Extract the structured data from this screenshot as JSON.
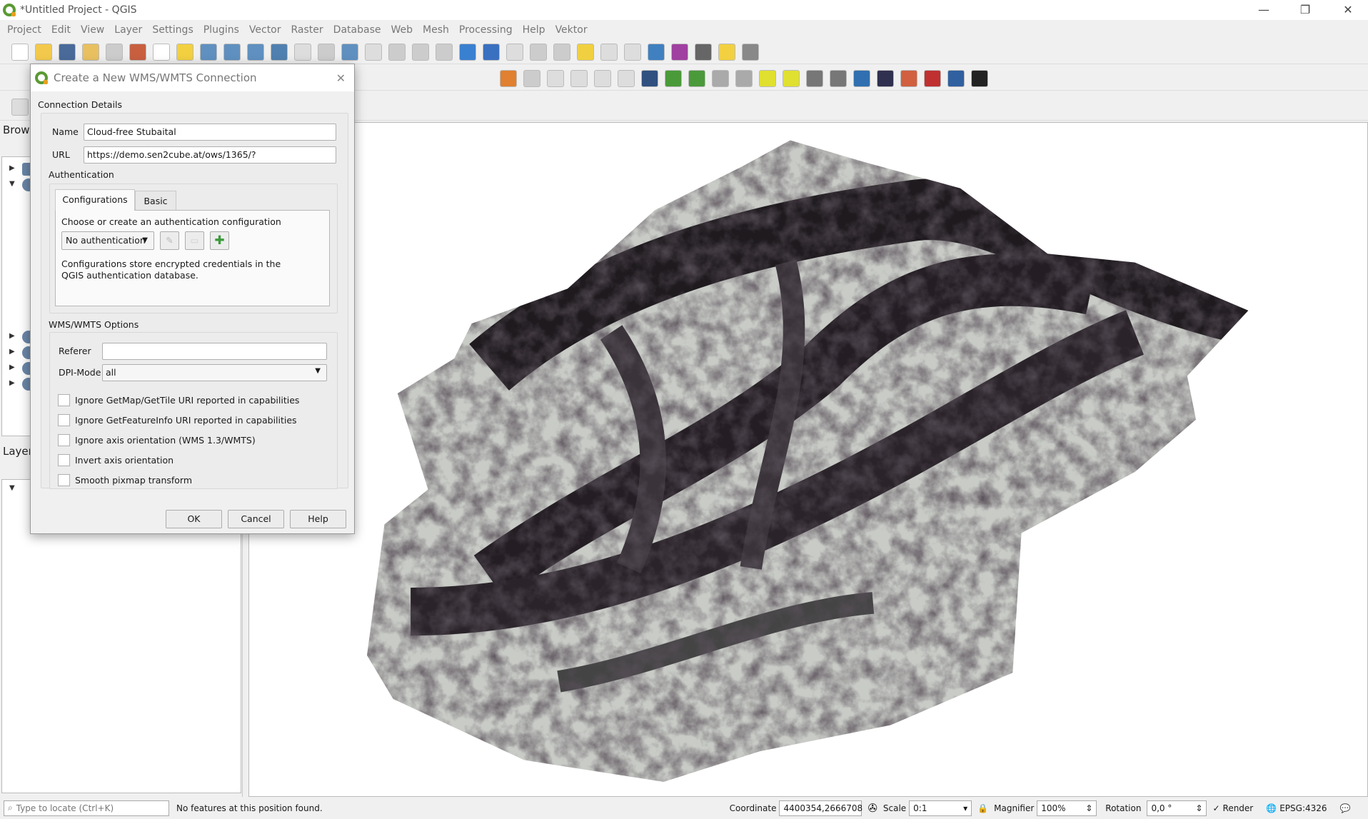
{
  "window": {
    "title": "*Untitled Project - QGIS",
    "minimize": "—",
    "restore": "❐",
    "close": "✕"
  },
  "menu": [
    "Project",
    "Edit",
    "View",
    "Layer",
    "Settings",
    "Plugins",
    "Vector",
    "Raster",
    "Database",
    "Web",
    "Mesh",
    "Processing",
    "Help",
    "Vektor"
  ],
  "toolbar1": [
    [
      "new-project",
      "#fff"
    ],
    [
      "open-project",
      "#f2c94c"
    ],
    [
      "save-project",
      "#4a6a9a"
    ],
    [
      "new-print-layout",
      "#e8c060"
    ],
    [
      "layout-manager",
      "#ccc"
    ],
    [
      "style-manager",
      "#c86040"
    ],
    [
      "pan",
      "#fff"
    ],
    [
      "pan-to-selection",
      "#f2d040"
    ],
    [
      "zoom-in",
      "#6090c0"
    ],
    [
      "zoom-out",
      "#6090c0"
    ],
    [
      "zoom-native",
      "#6090c0"
    ],
    [
      "zoom-full",
      "#5080b0"
    ],
    [
      "zoom-selection",
      "#ddd"
    ],
    [
      "zoom-layer",
      "#ccc"
    ],
    [
      "zoom-last",
      "#6090c0"
    ],
    [
      "zoom-next",
      "#ddd"
    ],
    [
      "new-map-view",
      "#ccc"
    ],
    [
      "new-3d-view",
      "#ccc"
    ],
    [
      "new-bookmark",
      "#ccc"
    ],
    [
      "refresh",
      "#3a80d0"
    ],
    [
      "identify",
      "#3a70c0"
    ],
    [
      "action",
      "#ddd"
    ],
    [
      "select",
      "#ccc"
    ],
    [
      "deselect",
      "#ccc"
    ],
    [
      "select-value",
      "#f0d040"
    ],
    [
      "attribute-table",
      "#ddd"
    ],
    [
      "field-calculator",
      "#ddd"
    ],
    [
      "processing-toolbox",
      "#4080c0"
    ],
    [
      "statistics",
      "#a040a0"
    ],
    [
      "measure",
      "#666"
    ],
    [
      "map-tips",
      "#f2d040"
    ],
    [
      "text-annotation",
      "#888"
    ]
  ],
  "toolbar2": [
    [
      "data-source-manager",
      "#e08030"
    ],
    [
      "cut",
      "#ccc"
    ],
    [
      "copy",
      "#ddd"
    ],
    [
      "paste",
      "#ddd"
    ],
    [
      "undo",
      "#ddd"
    ],
    [
      "redo",
      "#ddd"
    ],
    [
      "wms-search",
      "#305080"
    ],
    [
      "histogram",
      "#4a9a3a"
    ],
    [
      "histogram-stretch",
      "#4a9a3a"
    ],
    [
      "histogram-local",
      "#aaa"
    ],
    [
      "histogram-local-stretch",
      "#aaa"
    ],
    [
      "add-point",
      "#e0e030"
    ],
    [
      "add-line",
      "#e0e030"
    ],
    [
      "add-polygon",
      "#777"
    ],
    [
      "add-feature",
      "#777"
    ],
    [
      "python-console",
      "#3070b0"
    ],
    [
      "plugin-globe",
      "#303050"
    ],
    [
      "heatmap",
      "#d06040"
    ],
    [
      "wkt-tool",
      "#c03030"
    ],
    [
      "help",
      "#3060a0"
    ],
    [
      "s-plugin",
      "#222"
    ]
  ],
  "toolbar3": [
    [
      "new-layer",
      "#ddd"
    ]
  ],
  "browser": {
    "title": "Brows"
  },
  "layers": {
    "title": "Layers"
  },
  "dialog": {
    "title": "Create a New WMS/WMTS Connection",
    "connection_details": "Connection Details",
    "name_label": "Name",
    "name_value": "Cloud-free Stubaital",
    "url_label": "URL",
    "url_value": "https://demo.sen2cube.at/ows/1365/?",
    "auth_label": "Authentication",
    "tabs": [
      "Configurations",
      "Basic"
    ],
    "auth_choose": "Choose or create an authentication configuration",
    "auth_select": "No authentication",
    "auth_note": "Configurations store encrypted credentials in the QGIS authentication database.",
    "options_label": "WMS/WMTS Options",
    "referer_label": "Referer",
    "referer_value": "",
    "dpi_label": "DPI-Mode",
    "dpi_value": "all",
    "checkboxes": [
      {
        "label": "Ignore GetMap/GetTile URI reported in capabilities",
        "checked": false
      },
      {
        "label": "Ignore GetFeatureInfo URI reported in capabilities",
        "checked": false
      },
      {
        "label": "Ignore axis orientation (WMS 1.3/WMTS)",
        "checked": false
      },
      {
        "label": "Invert axis orientation",
        "checked": false
      },
      {
        "label": "Smooth pixmap transform",
        "checked": false
      }
    ],
    "ok": "OK",
    "cancel": "Cancel",
    "help": "Help"
  },
  "status": {
    "locate_placeholder": "Type to locate (Ctrl+K)",
    "message": "No features at this position found.",
    "coordinate_label": "Coordinate",
    "coordinate_value": "4400354,2666708",
    "scale_label": "Scale",
    "scale_value": "0:1",
    "magnifier_label": "Magnifier",
    "magnifier_value": "100%",
    "rotation_label": "Rotation",
    "rotation_value": "0,0 °",
    "render_label": "Render",
    "render_checked": true,
    "crs": "EPSG:4326"
  }
}
